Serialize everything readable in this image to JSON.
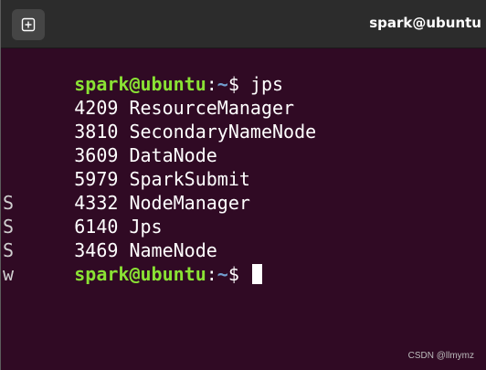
{
  "window": {
    "title": "spark@ubuntu",
    "new_tab_icon": "new-tab-icon"
  },
  "colors": {
    "terminal_bg": "#300a24",
    "titlebar_bg": "#2c2c2c",
    "prompt_user": "#8ae234",
    "prompt_path": "#729fcf",
    "text": "#ffffff"
  },
  "prompt": {
    "user_host": "spark@ubuntu",
    "separator": ":",
    "path": "~",
    "symbol": "$ "
  },
  "command": "jps",
  "output": [
    {
      "pid": "4209",
      "name": "ResourceManager",
      "edge": ""
    },
    {
      "pid": "3810",
      "name": "SecondaryNameNode",
      "edge": ""
    },
    {
      "pid": "3609",
      "name": "DataNode",
      "edge": ""
    },
    {
      "pid": "5979",
      "name": "SparkSubmit",
      "edge": ""
    },
    {
      "pid": "4332",
      "name": "NodeManager",
      "edge": "S"
    },
    {
      "pid": "6140",
      "name": "Jps",
      "edge": "S"
    },
    {
      "pid": "3469",
      "name": "NameNode",
      "edge": "S"
    }
  ],
  "last_prompt_edge": "w",
  "watermark": "CSDN @llmymz"
}
